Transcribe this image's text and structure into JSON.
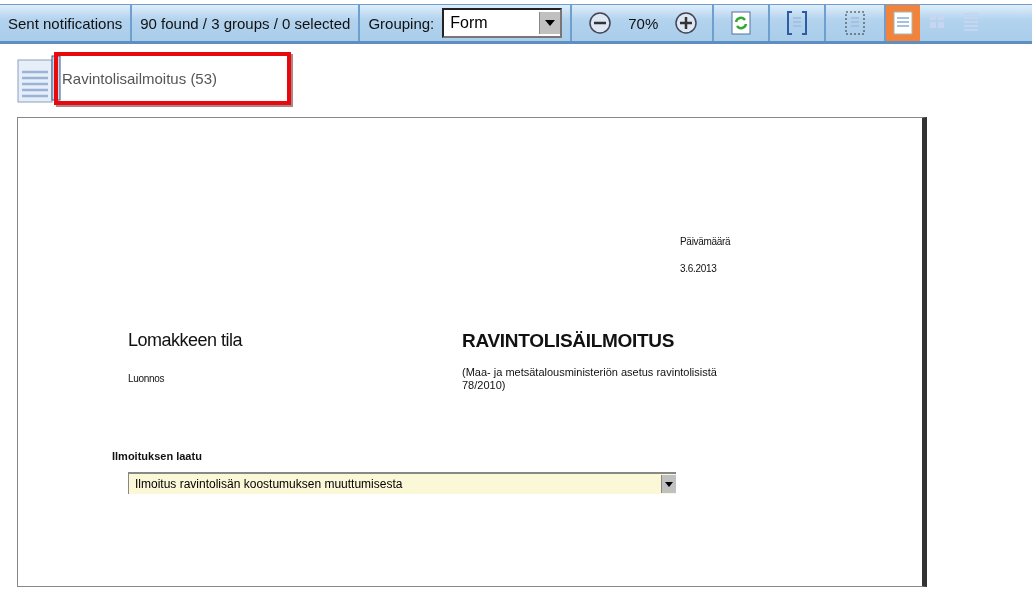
{
  "toolbar": {
    "title": "Sent notifications",
    "summary": "90 found / 3 groups / 0 selected",
    "grouping_label": "Grouping:",
    "grouping_value": "Form",
    "zoom": "70%",
    "view_modes": [
      {
        "kind": "page",
        "selected": true
      },
      {
        "kind": "grid",
        "selected": false
      },
      {
        "kind": "list",
        "selected": false
      }
    ]
  },
  "group": {
    "title": "Ravintolisailmoitus (53)",
    "highlighted": true
  },
  "form": {
    "date_label": "Päivämäärä",
    "date": "3.6.2013",
    "status_label": "Lomakkeen tila",
    "status": "Luonnos",
    "title": "RAVINTOLISÄILMOITUS",
    "subtitle": "(Maa- ja metsätalousministeriön asetus ravintolisistä 78/2010)",
    "type_label": "Ilmoituksen laatu",
    "type_value": "Ilmoitus ravintolisän koostumuksen muuttumisesta"
  }
}
